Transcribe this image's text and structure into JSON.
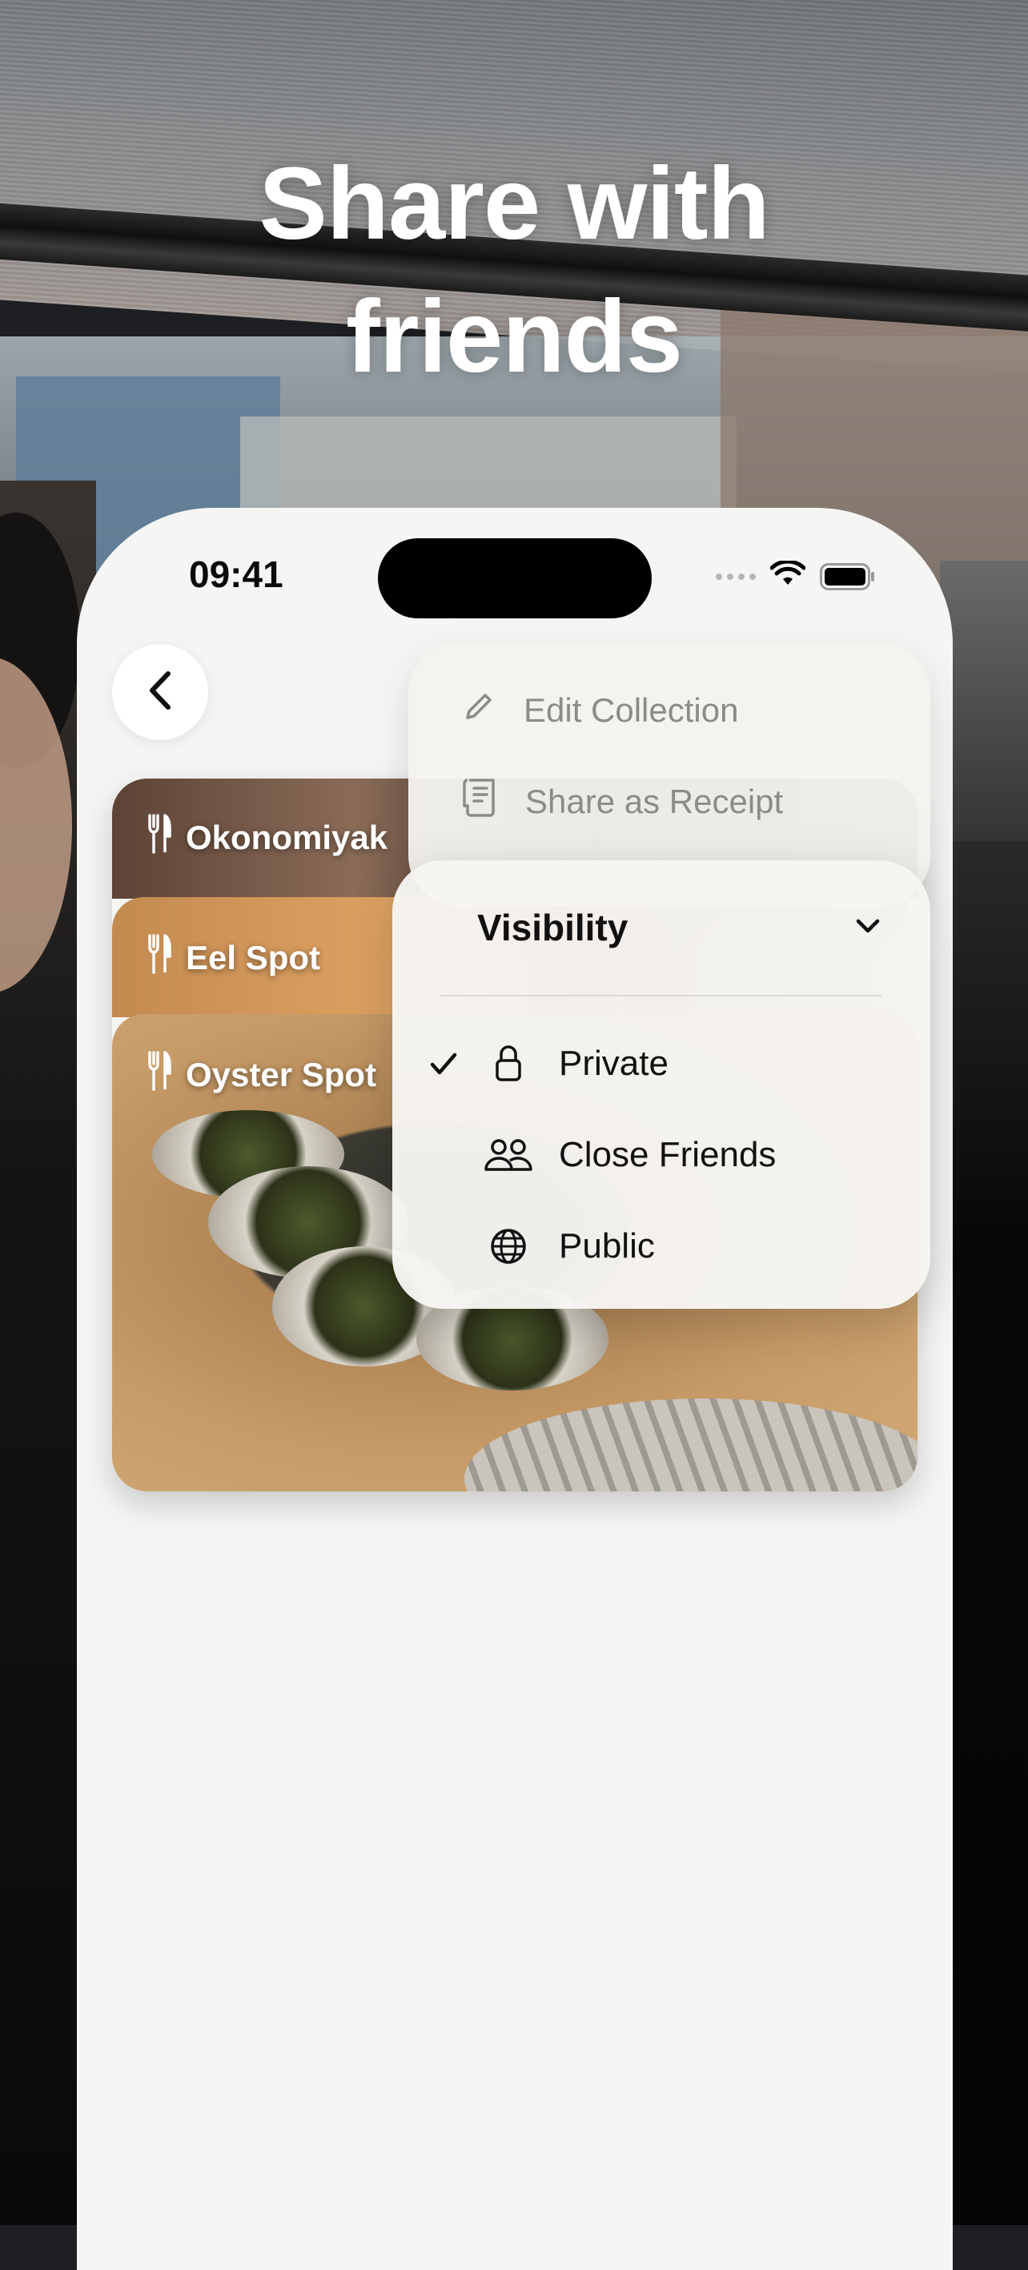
{
  "headline": {
    "line1": "Share with",
    "line2": "friends"
  },
  "status_bar": {
    "time": "09:41"
  },
  "collection_cards": [
    {
      "title": "Okonomiyak",
      "icon": "fork-knife-icon"
    },
    {
      "title": "Eel Spot",
      "icon": "fork-knife-icon"
    },
    {
      "title": "Oyster Spot",
      "icon": "fork-knife-icon"
    }
  ],
  "menu": {
    "items": [
      {
        "label": "Edit Collection",
        "icon": "pencil-icon"
      },
      {
        "label": "Share as Receipt",
        "icon": "receipt-icon"
      }
    ],
    "visibility": {
      "title": "Visibility",
      "options": [
        {
          "label": "Private",
          "icon": "lock-icon",
          "selected": true
        },
        {
          "label": "Close Friends",
          "icon": "people-icon",
          "selected": false
        },
        {
          "label": "Public",
          "icon": "globe-icon",
          "selected": false
        }
      ]
    }
  },
  "colors": {
    "headline_text": "#ffffff",
    "phone_background": "#f5f5f4",
    "menu_disabled_text": "#8c8b88",
    "menu_text": "#111111"
  }
}
